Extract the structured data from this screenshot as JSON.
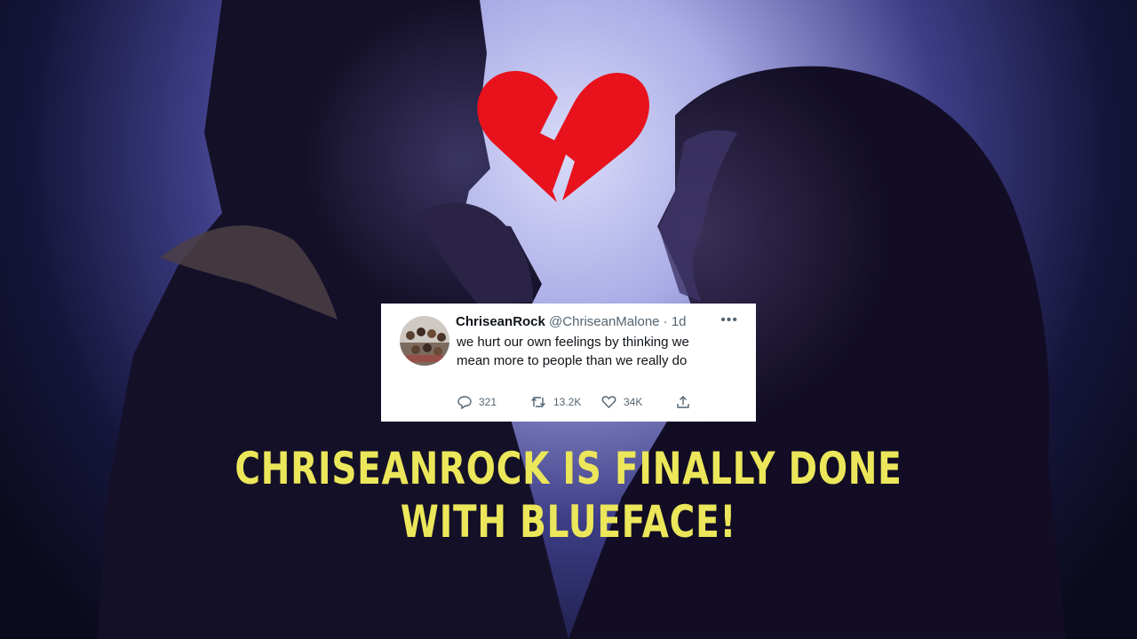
{
  "tweet": {
    "display_name": "ChriseanRock",
    "handle": "@ChriseanMalone",
    "separator": " · ",
    "age": "1d",
    "more_icon": "ellipsis-icon",
    "text": "we hurt our own feelings by thinking we mean more to people than we really do",
    "replies": "321",
    "retweets": "13.2K",
    "likes": "34K"
  },
  "headline": "CHRISEANROCK IS FINALLY DONE WITH BLUEFACE!",
  "emoji": "broken-heart",
  "colors": {
    "heart_red": "#e8121c",
    "headline_yellow": "#ece75a",
    "backdrop_light": "#d2d4f6",
    "backdrop_dark": "#0b0b1e",
    "silhouette": "#141028"
  }
}
